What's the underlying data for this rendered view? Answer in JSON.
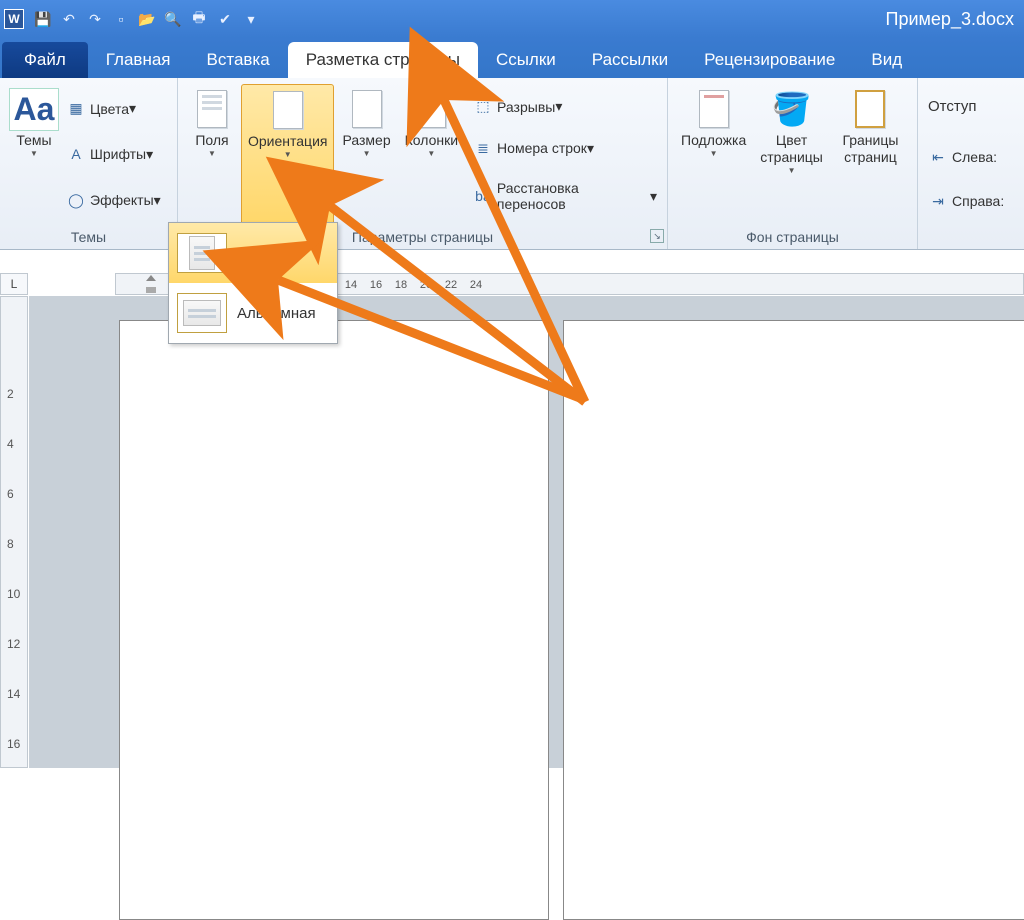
{
  "title": "Пример_3.docx",
  "qat": [
    "save",
    "undo",
    "redo",
    "new",
    "open",
    "preview",
    "quickprint",
    "spell",
    "mode",
    "more"
  ],
  "tabs": {
    "file": "Файл",
    "items": [
      "Главная",
      "Вставка",
      "Разметка страницы",
      "Ссылки",
      "Рассылки",
      "Рецензирование",
      "Вид"
    ],
    "active_index": 2
  },
  "ribbon": {
    "themes": {
      "title": "Темы",
      "themes_btn": "Темы",
      "colors": "Цвета",
      "fonts": "Шрифты",
      "effects": "Эффекты"
    },
    "page_setup": {
      "title": "Параметры страницы",
      "margins": "Поля",
      "orientation": "Ориентация",
      "size": "Размер",
      "columns": "Колонки",
      "breaks": "Разрывы",
      "line_numbers": "Номера строк",
      "hyphenation": "Расстановка переносов"
    },
    "page_bg": {
      "title": "Фон страницы",
      "watermark": "Подложка",
      "page_color": "Цвет страницы",
      "page_borders": "Границы страниц"
    },
    "paragraph": {
      "title": "Отступ",
      "left": "Слева:",
      "right": "Справа:"
    }
  },
  "orientation_menu": {
    "portrait": "Книжная",
    "landscape": "Альбомная"
  },
  "ruler_ticks": [
    14,
    16,
    18,
    20,
    22,
    24
  ],
  "vruler_ticks": [
    2,
    4,
    6,
    8,
    10,
    12,
    14,
    16
  ]
}
